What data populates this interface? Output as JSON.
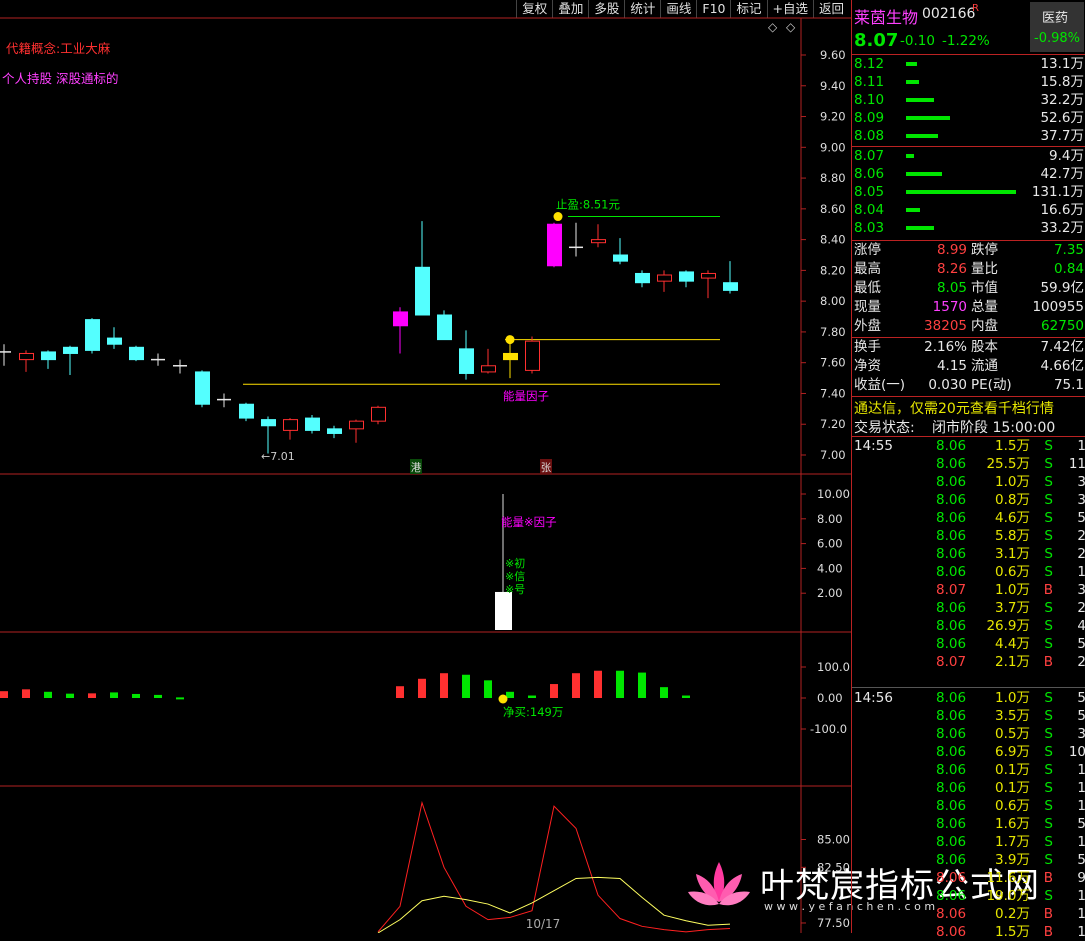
{
  "toolbar": [
    "复权",
    "叠加",
    "多股",
    "统计",
    "画线",
    "F10",
    "标记",
    "+自选",
    "返回"
  ],
  "chart_text": {
    "concept": "代籍概念:工业大麻",
    "holders": "个人持股 深股通标的",
    "stop_label": "止盈:8.51元",
    "energy_label": "能量因子",
    "low_label": "←7.01",
    "hk_badge": "港",
    "zhang_badge": "张",
    "ind1_label": "能量※因子",
    "signal_1": "※初",
    "signal_2": "※信",
    "signal_3": "※号",
    "net_buy": "净买:149万",
    "pager": "10/17",
    "watermark": "叶梵宸指标公式网",
    "watermark_url": "w w w . y e f a n c h e n . c o m",
    "symbol_glyph": "◇"
  },
  "axes": {
    "price": [
      "9.60",
      "9.40",
      "9.20",
      "9.00",
      "8.80",
      "8.60",
      "8.40",
      "8.20",
      "8.00",
      "7.80",
      "7.60",
      "7.40",
      "7.20",
      "7.00"
    ],
    "ind1": [
      "10.00",
      "8.00",
      "6.00",
      "4.00",
      "2.00"
    ],
    "ind2": [
      "100.0",
      "0.00",
      "-100.0"
    ],
    "ind3": [
      "85.00",
      "82.50",
      "77.50"
    ]
  },
  "chart_data": {
    "type": "candlestick",
    "ylim": [
      6.98,
      9.66
    ],
    "candles": [
      {
        "o": 7.67,
        "c": 7.67,
        "h": 7.72,
        "l": 7.58
      },
      {
        "o": 7.62,
        "c": 7.66,
        "h": 7.68,
        "l": 7.54
      },
      {
        "o": 7.67,
        "c": 7.62,
        "h": 7.68,
        "l": 7.56
      },
      {
        "o": 7.7,
        "c": 7.66,
        "h": 7.71,
        "l": 7.52
      },
      {
        "o": 7.88,
        "c": 7.68,
        "h": 7.89,
        "l": 7.66
      },
      {
        "o": 7.76,
        "c": 7.72,
        "h": 7.83,
        "l": 7.69
      },
      {
        "o": 7.7,
        "c": 7.62,
        "h": 7.71,
        "l": 7.61
      },
      {
        "o": 7.62,
        "c": 7.62,
        "h": 7.66,
        "l": 7.58
      },
      {
        "o": 7.58,
        "c": 7.58,
        "h": 7.62,
        "l": 7.53
      },
      {
        "o": 7.54,
        "c": 7.33,
        "h": 7.55,
        "l": 7.31
      },
      {
        "o": 7.36,
        "c": 7.36,
        "h": 7.4,
        "l": 7.31
      },
      {
        "o": 7.33,
        "c": 7.24,
        "h": 7.34,
        "l": 7.22
      },
      {
        "o": 7.23,
        "c": 7.19,
        "h": 7.25,
        "l": 7.01
      },
      {
        "o": 7.16,
        "c": 7.23,
        "h": 7.24,
        "l": 7.1
      },
      {
        "o": 7.24,
        "c": 7.16,
        "h": 7.26,
        "l": 7.14
      },
      {
        "o": 7.17,
        "c": 7.14,
        "h": 7.19,
        "l": 7.11
      },
      {
        "o": 7.17,
        "c": 7.22,
        "h": 7.23,
        "l": 7.08
      },
      {
        "o": 7.22,
        "c": 7.31,
        "h": 7.32,
        "l": 7.2
      },
      {
        "o": 7.84,
        "c": 7.93,
        "h": 7.96,
        "l": 7.66
      },
      {
        "o": 8.22,
        "c": 7.91,
        "h": 8.52,
        "l": 7.91
      },
      {
        "o": 7.91,
        "c": 7.75,
        "h": 7.94,
        "l": 7.75
      },
      {
        "o": 7.69,
        "c": 7.53,
        "h": 7.81,
        "l": 7.49
      },
      {
        "o": 7.54,
        "c": 7.58,
        "h": 7.69,
        "l": 7.53
      },
      {
        "o": 7.62,
        "c": 7.66,
        "h": 7.74,
        "l": 7.5
      },
      {
        "o": 7.55,
        "c": 7.74,
        "h": 7.77,
        "l": 7.53
      },
      {
        "o": 8.5,
        "c": 8.23,
        "h": 8.51,
        "l": 8.22
      },
      {
        "o": 8.35,
        "c": 8.35,
        "h": 8.51,
        "l": 8.29
      },
      {
        "o": 8.38,
        "c": 8.4,
        "h": 8.5,
        "l": 8.35
      },
      {
        "o": 8.3,
        "c": 8.26,
        "h": 8.41,
        "l": 8.24
      },
      {
        "o": 8.18,
        "c": 8.12,
        "h": 8.2,
        "l": 8.09
      },
      {
        "o": 8.13,
        "c": 8.17,
        "h": 8.2,
        "l": 8.06
      },
      {
        "o": 8.19,
        "c": 8.13,
        "h": 8.2,
        "l": 8.09
      },
      {
        "o": 8.15,
        "c": 8.18,
        "h": 8.2,
        "l": 8.02
      },
      {
        "o": 8.12,
        "c": 8.07,
        "h": 8.26,
        "l": 8.05
      }
    ],
    "stop_line": 8.55,
    "support_line": 7.46,
    "resist_line": 7.75,
    "ind1": {
      "ylim": [
        0,
        11
      ],
      "bar_index": 22,
      "value": 2.1,
      "tall_line": 10.0
    },
    "ind2": {
      "ylim": [
        -150,
        150
      ],
      "values": [
        22,
        28,
        20,
        14,
        15,
        18,
        13,
        10,
        2,
        0,
        0,
        0,
        0,
        0,
        0,
        0,
        0,
        0,
        38,
        62,
        80,
        75,
        57,
        20,
        8,
        45,
        80,
        88,
        88,
        82,
        35,
        8,
        0,
        0
      ],
      "colors": [
        "r",
        "r",
        "g",
        "g",
        "r",
        "g",
        "g",
        "g",
        "g",
        "n",
        "n",
        "n",
        "n",
        "n",
        "n",
        "n",
        "n",
        "n",
        "r",
        "r",
        "r",
        "g",
        "g",
        "g",
        "g",
        "r",
        "r",
        "r",
        "g",
        "g",
        "g",
        "g",
        "n",
        "n"
      ]
    },
    "ind3": {
      "ylim": [
        76.5,
        88
      ],
      "red": [
        null,
        null,
        null,
        null,
        null,
        null,
        null,
        null,
        null,
        null,
        null,
        null,
        null,
        null,
        null,
        null,
        null,
        76.7,
        79.0,
        88.3,
        82.5,
        79.0,
        77.8,
        78.0,
        78.6,
        88.0,
        86.0,
        80.0,
        77.9,
        77.2,
        76.9,
        76.7,
        76.9,
        77.0
      ],
      "yellow": [
        null,
        null,
        null,
        null,
        null,
        null,
        null,
        null,
        null,
        null,
        null,
        null,
        null,
        null,
        null,
        null,
        null,
        76.6,
        77.8,
        79.5,
        79.9,
        79.6,
        79.2,
        78.4,
        79.3,
        80.4,
        81.5,
        81.6,
        81.5,
        79.8,
        78.2,
        77.7,
        77.3,
        77.4
      ]
    }
  },
  "quote": {
    "name": "莱茵生物",
    "code": "002166",
    "r_mark": "R",
    "sector": "医药",
    "sector_change": "-0.98%",
    "price": "8.07",
    "change": "-0.10",
    "change_pct": "-1.22%",
    "asks": [
      {
        "p": "8.12",
        "v": "13.1万",
        "w": 0.1
      },
      {
        "p": "8.11",
        "v": "15.8万",
        "w": 0.12
      },
      {
        "p": "8.10",
        "v": "32.2万",
        "w": 0.25
      },
      {
        "p": "8.09",
        "v": "52.6万",
        "w": 0.4
      },
      {
        "p": "8.08",
        "v": "37.7万",
        "w": 0.29
      }
    ],
    "bids": [
      {
        "p": "8.07",
        "v": "9.4万",
        "w": 0.07
      },
      {
        "p": "8.06",
        "v": "42.7万",
        "w": 0.33
      },
      {
        "p": "8.05",
        "v": "131.1万",
        "w": 1.0
      },
      {
        "p": "8.04",
        "v": "16.6万",
        "w": 0.13
      },
      {
        "p": "8.03",
        "v": "33.2万",
        "w": 0.25
      }
    ],
    "stats": [
      {
        "l1": "涨停",
        "v1": "8.99",
        "c1": "red",
        "l2": "跌停",
        "v2": "7.35",
        "c2": "green"
      },
      {
        "l1": "最高",
        "v1": "8.26",
        "c1": "red",
        "l2": "量比",
        "v2": "0.84",
        "c2": "green"
      },
      {
        "l1": "最低",
        "v1": "8.05",
        "c1": "green",
        "l2": "市值",
        "v2": "59.9亿",
        "c2": "white"
      },
      {
        "l1": "现量",
        "v1": "1570",
        "c1": "mag",
        "l2": "总量",
        "v2": "100955",
        "c2": "white"
      },
      {
        "l1": "外盘",
        "v1": "38205",
        "c1": "red",
        "l2": "内盘",
        "v2": "62750",
        "c2": "green"
      }
    ],
    "stats2": [
      {
        "l1": "换手",
        "v1": "2.16%",
        "c1": "white",
        "l2": "股本",
        "v2": "7.42亿",
        "c2": "white"
      },
      {
        "l1": "净资",
        "v1": "4.15",
        "c1": "white",
        "l2": "流通",
        "v2": "4.66亿",
        "c2": "white"
      },
      {
        "l1": "收益(一)",
        "v1": "0.030",
        "c1": "white",
        "l2": "PE(动)",
        "v2": "75.1",
        "c2": "white"
      }
    ],
    "promo": "通达信，仅需20元查看千档行情",
    "status_label": "交易状态:",
    "status_value": "闭市阶段 15:00:00"
  },
  "ticks": [
    {
      "t": "14:55",
      "p": "8.06",
      "v": "1.5万",
      "s": "S",
      "n": "1"
    },
    {
      "t": "",
      "p": "8.06",
      "v": "25.5万",
      "s": "S",
      "n": "11"
    },
    {
      "t": "",
      "p": "8.06",
      "v": "1.0万",
      "s": "S",
      "n": "3"
    },
    {
      "t": "",
      "p": "8.06",
      "v": "0.8万",
      "s": "S",
      "n": "3"
    },
    {
      "t": "",
      "p": "8.06",
      "v": "4.6万",
      "s": "S",
      "n": "5"
    },
    {
      "t": "",
      "p": "8.06",
      "v": "5.8万",
      "s": "S",
      "n": "2"
    },
    {
      "t": "",
      "p": "8.06",
      "v": "3.1万",
      "s": "S",
      "n": "2"
    },
    {
      "t": "",
      "p": "8.06",
      "v": "0.6万",
      "s": "S",
      "n": "1"
    },
    {
      "t": "",
      "p": "8.07",
      "v": "1.0万",
      "s": "B",
      "n": "3"
    },
    {
      "t": "",
      "p": "8.06",
      "v": "3.7万",
      "s": "S",
      "n": "2"
    },
    {
      "t": "",
      "p": "8.06",
      "v": "26.9万",
      "s": "S",
      "n": "4"
    },
    {
      "t": "",
      "p": "8.06",
      "v": "4.4万",
      "s": "S",
      "n": "5"
    },
    {
      "t": "",
      "p": "8.07",
      "v": "2.1万",
      "s": "B",
      "n": "2"
    },
    {
      "t": "14:56",
      "p": "8.06",
      "v": "1.0万",
      "s": "S",
      "n": "5"
    },
    {
      "t": "",
      "p": "8.06",
      "v": "3.5万",
      "s": "S",
      "n": "5"
    },
    {
      "t": "",
      "p": "8.06",
      "v": "0.5万",
      "s": "S",
      "n": "3"
    },
    {
      "t": "",
      "p": "8.06",
      "v": "6.9万",
      "s": "S",
      "n": "10"
    },
    {
      "t": "",
      "p": "8.06",
      "v": "0.1万",
      "s": "S",
      "n": "1"
    },
    {
      "t": "",
      "p": "8.06",
      "v": "0.1万",
      "s": "S",
      "n": "1"
    },
    {
      "t": "",
      "p": "8.06",
      "v": "0.6万",
      "s": "S",
      "n": "1"
    },
    {
      "t": "",
      "p": "8.06",
      "v": "1.6万",
      "s": "S",
      "n": "5"
    },
    {
      "t": "",
      "p": "8.06",
      "v": "1.7万",
      "s": "S",
      "n": "1"
    },
    {
      "t": "",
      "p": "8.06",
      "v": "3.9万",
      "s": "S",
      "n": "5"
    },
    {
      "t": "",
      "p": "8.06",
      "v": "11.6万",
      "s": "B",
      "n": "9"
    },
    {
      "t": "",
      "p": "8.06",
      "v": "19.0万",
      "s": "S",
      "n": "1"
    },
    {
      "t": "",
      "p": "8.06",
      "v": "0.2万",
      "s": "B",
      "n": "1"
    },
    {
      "t": "",
      "p": "8.06",
      "v": "1.5万",
      "s": "B",
      "n": "1"
    }
  ],
  "colors": {
    "up": "#ff3030",
    "down": "#54ffff",
    "grid": "#b22222",
    "yellow": "#ffe000",
    "magenta": "#ff00ff",
    "green": "#00e600"
  }
}
